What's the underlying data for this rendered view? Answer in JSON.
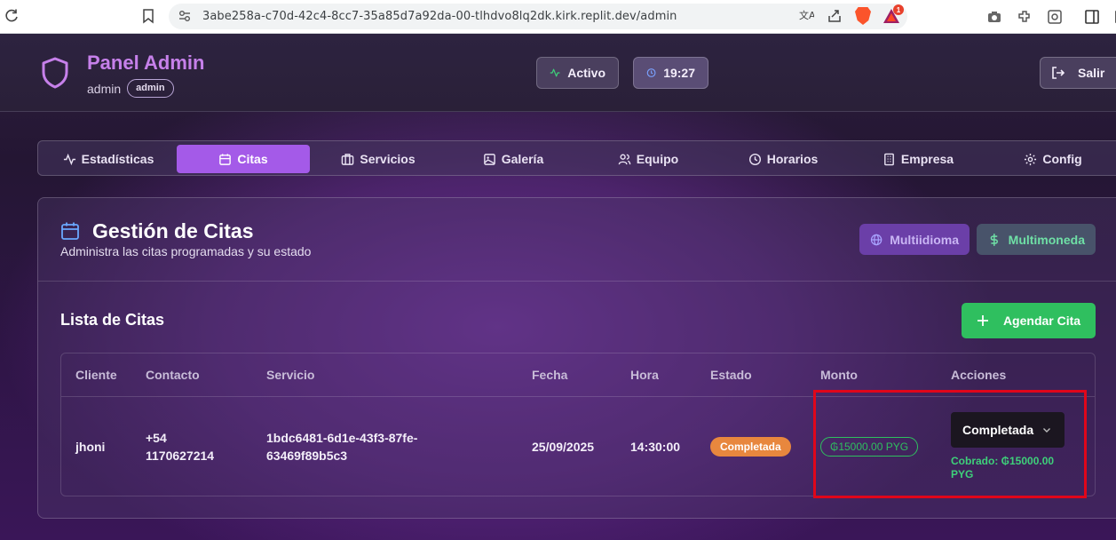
{
  "browser": {
    "url": "3abe258a-c70d-42c4-8cc7-35a85d7a92da-00-tlhdvo8lq2dk.kirk.replit.dev/admin",
    "notification_count": "1"
  },
  "header": {
    "title": "Panel Admin",
    "username": "admin",
    "role": "admin",
    "status_label": "Activo",
    "time": "19:27",
    "logout_label": "Salir"
  },
  "tabs": [
    {
      "label": "Estadísticas",
      "icon": "activity-icon"
    },
    {
      "label": "Citas",
      "icon": "calendar-icon",
      "active": true
    },
    {
      "label": "Servicios",
      "icon": "briefcase-icon"
    },
    {
      "label": "Galería",
      "icon": "image-icon"
    },
    {
      "label": "Equipo",
      "icon": "users-icon"
    },
    {
      "label": "Horarios",
      "icon": "clock-icon"
    },
    {
      "label": "Empresa",
      "icon": "building-icon"
    },
    {
      "label": "Config",
      "icon": "gear-icon"
    }
  ],
  "card": {
    "title": "Gestión de Citas",
    "subtitle": "Administra las citas programadas y su estado",
    "badge_language": "Multiidioma",
    "badge_currency": "Multimoneda",
    "list_title": "Lista de Citas",
    "add_button": "Agendar Cita"
  },
  "table": {
    "columns": [
      "Cliente",
      "Contacto",
      "Servicio",
      "Fecha",
      "Hora",
      "Estado",
      "Monto",
      "Acciones"
    ],
    "rows": [
      {
        "client": "jhoni",
        "contact_line1": "+54",
        "contact_line2": "1170627214",
        "service_line1": "1bdc6481-6d1e-43f3-87fe-",
        "service_line2": "63469f89b5c3",
        "date": "25/09/2025",
        "time": "14:30:00",
        "status": "Completada",
        "amount": "₲15000.00 PYG",
        "action_selected": "Completada",
        "paid_line1": "Cobrado: ₲15000.00",
        "paid_line2": "PYG"
      }
    ]
  },
  "colors": {
    "accent": "#a45ae8",
    "brand_title": "#c680ea",
    "success": "#2fbf5f",
    "status_completed": "#e8873e",
    "highlight": "#e0061a"
  }
}
